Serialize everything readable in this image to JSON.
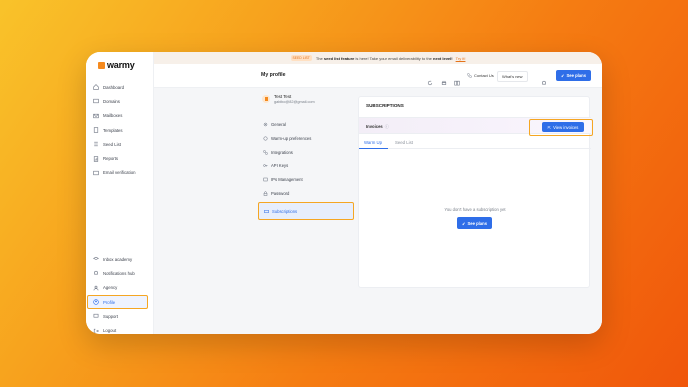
{
  "brand": {
    "name": "warmy",
    "accent": "#2f6ee8",
    "highlight": "#f5a623",
    "logo_color": "#f58a1f"
  },
  "banner": {
    "badge": "SEED LIST",
    "text_pre": "The",
    "feature": "seed list feature",
    "text_mid": "is here! Take your email deliverability to the",
    "emphasis": "next level!",
    "link": "Try it!"
  },
  "header": {
    "title": "My profile",
    "contact": "Contact Us",
    "whats_new": "What's new",
    "see_plans": "See plans"
  },
  "sidebar": {
    "items": [
      {
        "label": "Dashboard",
        "icon": "home-icon"
      },
      {
        "label": "Domains",
        "icon": "domain-icon"
      },
      {
        "label": "Mailboxes",
        "icon": "mailbox-icon"
      },
      {
        "label": "Templates",
        "icon": "template-icon"
      },
      {
        "label": "Seed List",
        "icon": "list-icon"
      },
      {
        "label": "Reports",
        "icon": "report-icon"
      },
      {
        "label": "Email verification",
        "icon": "verify-icon"
      }
    ],
    "bottom_items": [
      {
        "label": "Inbox academy",
        "icon": "academy-icon"
      },
      {
        "label": "Notifications hub",
        "icon": "bell-icon"
      },
      {
        "label": "Agency",
        "icon": "agency-icon"
      },
      {
        "label": "Profile",
        "icon": "user-icon"
      },
      {
        "label": "Support",
        "icon": "support-icon"
      },
      {
        "label": "Logout",
        "icon": "logout-icon"
      }
    ]
  },
  "profile": {
    "name": "Test Test",
    "email": "gabibo@82@gmail.com",
    "menu": [
      {
        "label": "General"
      },
      {
        "label": "Warm-up preferences"
      },
      {
        "label": "Integrations"
      },
      {
        "label": "API Keys"
      },
      {
        "label": "IPs Management"
      },
      {
        "label": "Password"
      },
      {
        "label": "Subscriptions"
      }
    ]
  },
  "subscriptions": {
    "title": "SUBSCRIPTIONS",
    "invoices_label": "Invoices",
    "view_invoices": "View invoices",
    "tabs": [
      "Warm Up",
      "Seed List"
    ],
    "empty_message": "You don't have a subscription yet",
    "see_plans": "See plans"
  }
}
